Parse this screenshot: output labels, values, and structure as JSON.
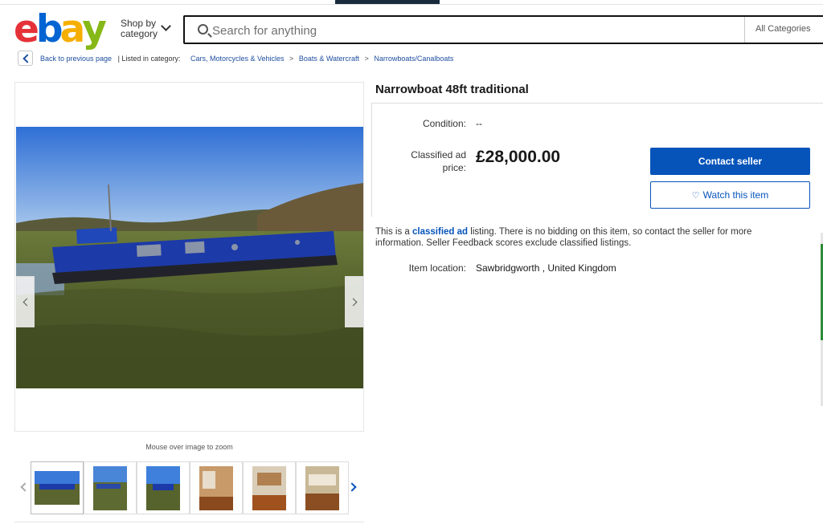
{
  "header": {
    "logo_letters": [
      "e",
      "b",
      "a",
      "y"
    ],
    "shop_by_line1": "Shop by",
    "shop_by_line2": "category",
    "search_placeholder": "Search for anything",
    "search_value": "",
    "category_select": "All Categories"
  },
  "breadcrumb": {
    "back_label": "Back to previous page",
    "listed_in": "| Listed in category:",
    "items": [
      "Cars, Motorcycles & Vehicles",
      "Boats & Watercraft",
      "Narrowboats/Canalboats"
    ],
    "separator": ">"
  },
  "gallery": {
    "zoom_hint": "Mouse over image to zoom",
    "thumb_count": 6,
    "active_thumb": 0
  },
  "listing": {
    "title": "Narrowboat 48ft traditional",
    "condition_label": "Condition:",
    "condition_value": "--",
    "price_label_line1": "Classified ad",
    "price_label_line2": "price:",
    "price": "£28,000.00",
    "contact_button": "Contact seller",
    "watch_button": "Watch this item",
    "notice_prefix": "This is a",
    "notice_link": "classified ad",
    "notice_rest": "listing. There is no bidding on this item, so contact the seller for more information. Seller Feedback scores exclude classified listings.",
    "location_label": "Item location:",
    "location_value": "Sawbridgworth , United Kingdom"
  },
  "colors": {
    "primary_blue": "#0654ba",
    "link_blue": "#1f4fa0",
    "logo_red": "#e53238",
    "logo_blue": "#0064d2",
    "logo_yellow": "#f5af02",
    "logo_green": "#86b817"
  }
}
